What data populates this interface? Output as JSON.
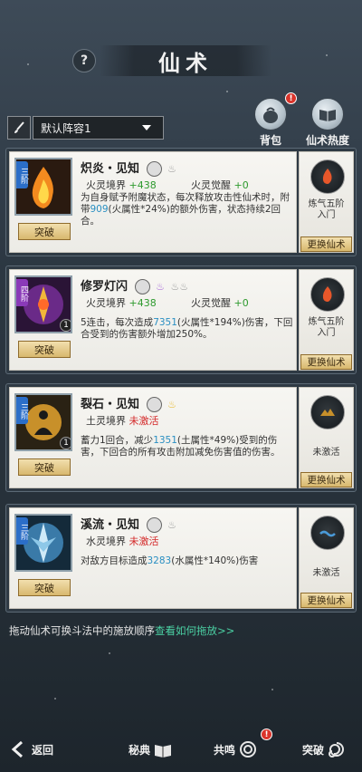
{
  "header": {
    "title": "仙术",
    "help_label": "?"
  },
  "lineup": {
    "selected": "默认阵容1"
  },
  "top_buttons": [
    {
      "label": "背包",
      "badge": "!"
    },
    {
      "label": "仙术热度"
    }
  ],
  "skills": [
    {
      "grade": "三阶",
      "name": "炽炎・见知",
      "realm_label": "火灵境界",
      "realm_value": "+438",
      "awaken_label": "火灵觉醒",
      "awaken_value": "+0",
      "desc_parts": [
        "为自身赋予附魔状态，每次释放攻击性仙术时，附带",
        "909",
        "(火属性*24%)的额外伤害，状态持续2回合。"
      ],
      "breakthrough": "突破",
      "element_status": "炼气五阶\n入门",
      "change": "更换仙术",
      "color": "#e8572a"
    },
    {
      "grade": "四阶",
      "name": "修罗灯闪",
      "count": "1",
      "realm_label": "火灵境界",
      "realm_value": "+438",
      "awaken_label": "火灵觉醒",
      "awaken_value": "+0",
      "desc_parts": [
        "5连击，每次造成",
        "7351",
        "(火属性*194%)伤害，下回合受到的伤害额外增加250%。"
      ],
      "breakthrough": "突破",
      "element_status": "炼气五阶\n入门",
      "change": "更换仙术",
      "color": "#b04ac8"
    },
    {
      "grade": "三阶",
      "name": "裂石・见知",
      "count": "1",
      "realm_label": "土灵境界",
      "realm_value": "未激活",
      "desc_parts": [
        "蓄力1回合，减少",
        "1351",
        "(土属性*49%)受到的伤害，下回合的所有攻击附加减免伤害值的伤害。"
      ],
      "breakthrough": "突破",
      "element_status": "未激活",
      "change": "更换仙术",
      "color": "#c8902a"
    },
    {
      "grade": "三阶",
      "name": "溪流・见知",
      "realm_label": "水灵境界",
      "realm_value": "未激活",
      "desc_parts": [
        "对敌方目标造成",
        "3283",
        "(水属性*140%)伤害"
      ],
      "breakthrough": "突破",
      "element_status": "未激活",
      "change": "更换仙术",
      "color": "#4a9ad8"
    }
  ],
  "hint": {
    "text": "拖动仙术可换斗法中的施放顺序",
    "link": "查看如何拖放>>"
  },
  "bottom_nav": [
    {
      "label": "返回"
    },
    {
      "label": "秘典"
    },
    {
      "label": "共鸣",
      "badge": "!"
    },
    {
      "label": "突破"
    }
  ]
}
